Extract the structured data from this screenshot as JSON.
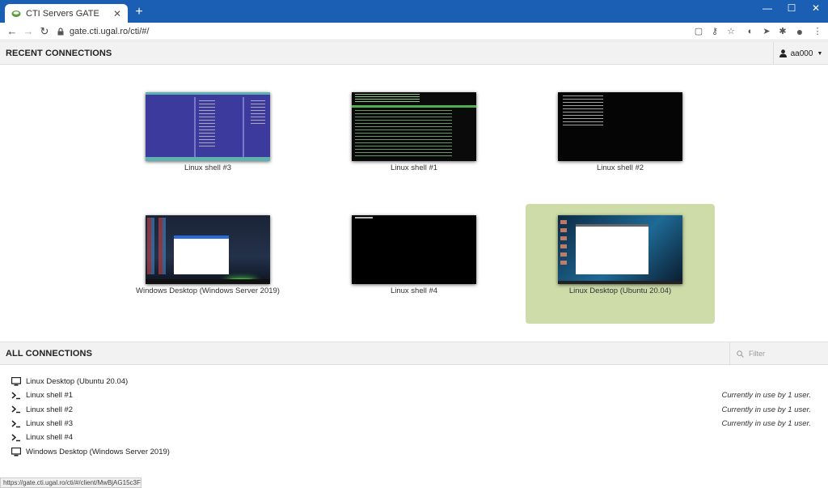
{
  "browser": {
    "tab_title": "CTI Servers GATE",
    "tab_close": "✕",
    "new_tab": "+",
    "url": "gate.cti.ugal.ro/cti/#/",
    "status_url": "https://gate.cti.ugal.ro/cti/#/client/MwBjAG15c3Fs"
  },
  "header": {
    "title": "RECENT CONNECTIONS",
    "username": "aa000"
  },
  "recent": [
    {
      "label": "Linux shell #3",
      "selected": false
    },
    {
      "label": "Linux shell #1",
      "selected": false
    },
    {
      "label": "Linux shell #2",
      "selected": false
    },
    {
      "label": "Windows Desktop (Windows Server 2019)",
      "selected": false
    },
    {
      "label": "Linux shell #4",
      "selected": false
    },
    {
      "label": "Linux Desktop (Ubuntu 20.04)",
      "selected": true
    }
  ],
  "all": {
    "title": "ALL CONNECTIONS",
    "filter_placeholder": "Filter",
    "items": [
      {
        "label": "Linux Desktop (Ubuntu 20.04)",
        "icon": "monitor-icon",
        "status": ""
      },
      {
        "label": "Linux shell #1",
        "icon": "terminal-icon",
        "status": "Currently in use by 1 user."
      },
      {
        "label": "Linux shell #2",
        "icon": "terminal-icon",
        "status": "Currently in use by 1 user."
      },
      {
        "label": "Linux shell #3",
        "icon": "terminal-icon",
        "status": "Currently in use by 1 user."
      },
      {
        "label": "Linux shell #4",
        "icon": "terminal-icon",
        "status": ""
      },
      {
        "label": "Windows Desktop (Windows Server 2019)",
        "icon": "monitor-icon",
        "status": ""
      }
    ]
  },
  "colors": {
    "titlebar": "#1b5fb4",
    "selected_tile": "#cddca9"
  }
}
